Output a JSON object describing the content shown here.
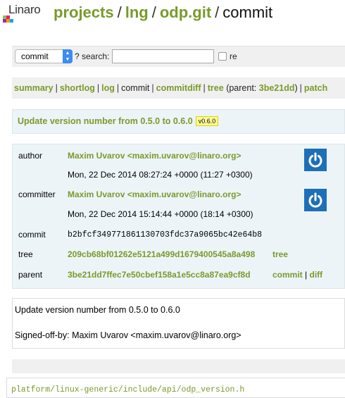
{
  "header": {
    "logo_text": "Linaro",
    "breadcrumbs": [
      "projects",
      "lng",
      "odp.git"
    ],
    "current": "commit"
  },
  "search": {
    "select_value": "commit",
    "label": "? search:",
    "input_value": "",
    "regex_label": "re"
  },
  "nav": {
    "links": [
      "summary",
      "shortlog",
      "log",
      "commit",
      "commitdiff",
      "tree"
    ],
    "parent_label": "(parent:",
    "parent_hash": "3be21dd",
    "parent_close": ")",
    "patch": "patch"
  },
  "commit": {
    "subject": "Update version number from 0.5.0 to 0.6.0",
    "tag": "v0.6.0",
    "author_label": "author",
    "author": "Maxim Uvarov <maxim.uvarov@linaro.org>",
    "author_date": "Mon, 22 Dec 2014 08:27:24 +0000 (11:27 +0300)",
    "committer_label": "committer",
    "committer": "Maxim Uvarov <maxim.uvarov@linaro.org>",
    "committer_date": "Mon, 22 Dec 2014 15:14:44 +0000 (18:14 +0300)",
    "commit_label": "commit",
    "commit_hash": "b2bfcf349771861130703fdc37a9065bc42e64b8",
    "tree_label": "tree",
    "tree_hash": "209cb68bf01262e5121a499d1679400545a8a498",
    "tree_link": "tree",
    "parent_label": "parent",
    "parent_hash": "3be21dd7ffec7e50cbef158a1e5cc8a87ea9cf8d",
    "parent_commit_link": "commit",
    "parent_diff_link": "diff"
  },
  "message": {
    "line1": "Update version number from 0.5.0 to 0.6.0",
    "line2": "Signed-off-by: Maxim Uvarov <maxim.uvarov@linaro.org>"
  },
  "files": [
    "platform/linux-generic/include/api/odp_version.h"
  ],
  "colors": {
    "link": "#7a9a2b",
    "avatar": "#1d6fb7",
    "tag_bg": "#ffff99",
    "panel_bg": "#edf4f8",
    "bar_bg": "#f0f0f0"
  },
  "icons": {
    "avatar": "power-icon",
    "select": "chevron-updown-icon"
  }
}
